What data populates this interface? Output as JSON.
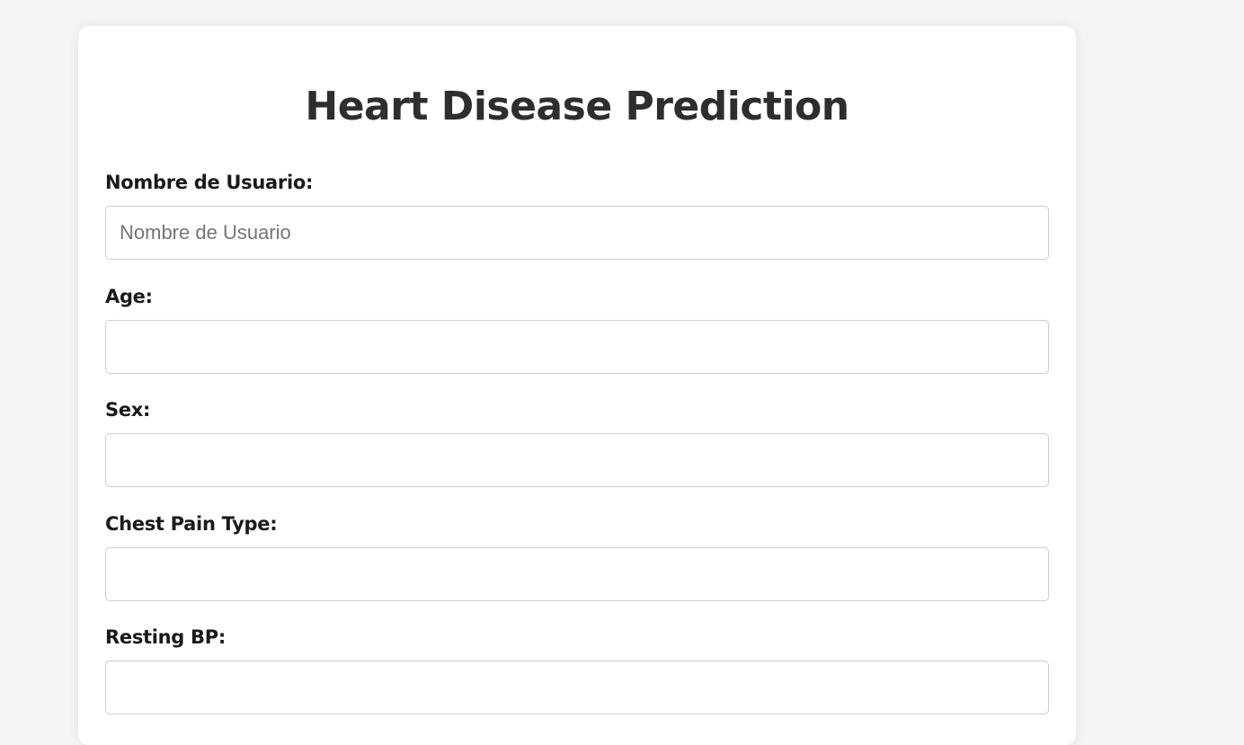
{
  "page": {
    "title": "Heart Disease Prediction"
  },
  "form": {
    "fields": [
      {
        "label": "Nombre de Usuario:",
        "placeholder": "Nombre de Usuario",
        "value": ""
      },
      {
        "label": "Age:",
        "placeholder": "",
        "value": ""
      },
      {
        "label": "Sex:",
        "placeholder": "",
        "value": ""
      },
      {
        "label": "Chest Pain Type:",
        "placeholder": "",
        "value": ""
      },
      {
        "label": "Resting BP:",
        "placeholder": "",
        "value": ""
      }
    ]
  }
}
